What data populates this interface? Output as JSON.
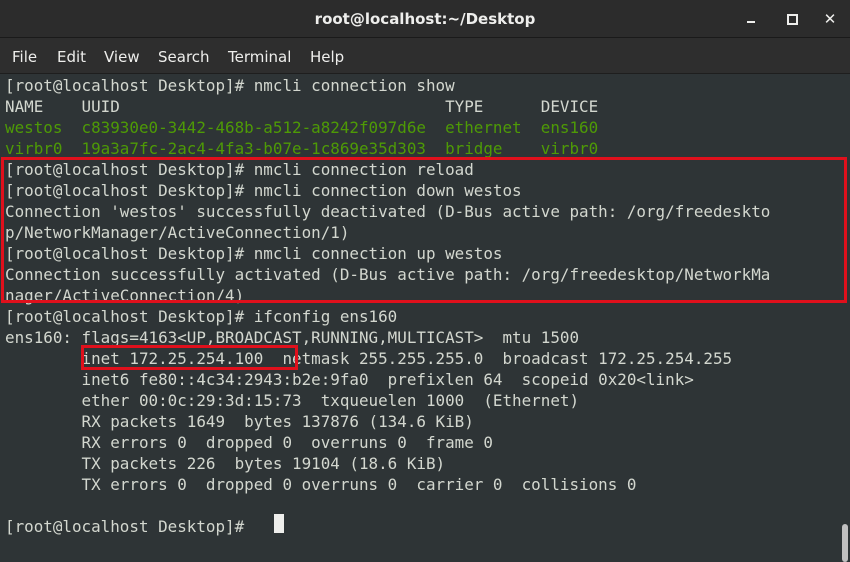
{
  "window": {
    "title": "root@localhost:~/Desktop",
    "minimize_icon": "minimize-icon",
    "maximize_icon": "maximize-icon",
    "close_icon": "close-icon",
    "close_glyph": "✕"
  },
  "menu": {
    "file": "File",
    "edit": "Edit",
    "view": "View",
    "search": "Search",
    "terminal": "Terminal",
    "help": "Help"
  },
  "terminal": {
    "lines": [
      "[root@localhost Desktop]# nmcli connection show",
      "NAME    UUID                                  TYPE      DEVICE",
      "westos  c83930e0-3442-468b-a512-a8242f097d6e  ethernet  ens160",
      "virbr0  19a3a7fc-2ac4-4fa3-b07e-1c869e35d303  bridge    virbr0",
      "[root@localhost Desktop]# nmcli connection reload",
      "[root@localhost Desktop]# nmcli connection down westos",
      "Connection 'westos' successfully deactivated (D-Bus active path: /org/freedeskto",
      "p/NetworkManager/ActiveConnection/1)",
      "[root@localhost Desktop]# nmcli connection up westos",
      "Connection successfully activated (D-Bus active path: /org/freedesktop/NetworkMa",
      "nager/ActiveConnection/4)",
      "[root@localhost Desktop]# ifconfig ens160",
      "ens160: flags=4163<UP,BROADCAST,RUNNING,MULTICAST>  mtu 1500",
      "        inet 172.25.254.100  netmask 255.255.255.0  broadcast 172.25.254.255",
      "        inet6 fe80::4c34:2943:b2e:9fa0  prefixlen 64  scopeid 0x20<link>",
      "        ether 00:0c:29:3d:15:73  txqueuelen 1000  (Ethernet)",
      "        RX packets 1649  bytes 137876 (134.6 KiB)",
      "        RX errors 0  dropped 0  overruns 0  frame 0",
      "        TX packets 226  bytes 19104 (18.6 KiB)",
      "        TX errors 0  dropped 0 overruns 0  carrier 0  collisions 0",
      "",
      "[root@localhost Desktop]# "
    ]
  },
  "colors": {
    "terminal_bg": "#2e3436",
    "text": "#d3d7cf",
    "green": "#4e9a06",
    "highlight": "#e0101c"
  }
}
